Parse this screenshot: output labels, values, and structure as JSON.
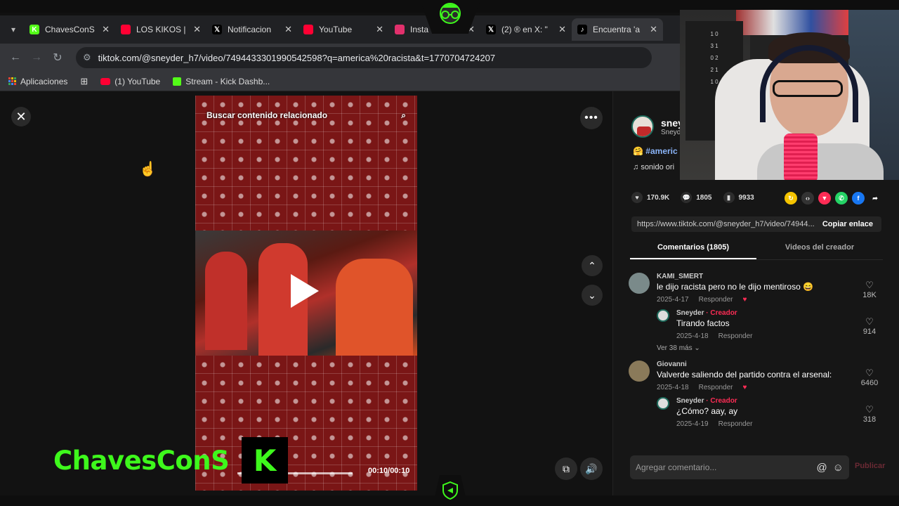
{
  "browser": {
    "tabs": [
      {
        "label": "ChavesConS",
        "icon": "kick-icon",
        "color": "#53fc18",
        "active": false
      },
      {
        "label": "LOS KIKOS |",
        "icon": "youtube-icon",
        "color": "#ff0033",
        "active": false
      },
      {
        "label": "Notificacion",
        "icon": "x-icon",
        "color": "#000000",
        "active": false
      },
      {
        "label": "YouTube",
        "icon": "youtube-icon",
        "color": "#ff0033",
        "active": false
      },
      {
        "label": "Insta",
        "icon": "instagram-icon",
        "color": "#e1306c",
        "active": false
      },
      {
        "label": "(2) ® en X: \"",
        "icon": "x-icon",
        "color": "#000000",
        "active": false
      },
      {
        "label": "Encuentra 'a",
        "icon": "tiktok-icon",
        "color": "#000000",
        "active": true
      }
    ],
    "url": "tiktok.com/@sneyder_h7/video/7494433301990542598?q=america%20racista&t=1770704724207",
    "bookmarks": [
      {
        "label": "Aplicaciones",
        "icon": "apps-grid-icon"
      },
      {
        "label": "(1) YouTube",
        "icon": "youtube-icon"
      },
      {
        "label": "Stream - Kick Dashb...",
        "icon": "kick-icon"
      }
    ]
  },
  "video": {
    "search_overlay": "Buscar contenido relacionado",
    "time": "00:10/00:10",
    "progress": 1.0
  },
  "creator": {
    "handle": "sney",
    "name": "Sneyd",
    "hashtag": "#americ",
    "sound": "sonido ori",
    "stats": {
      "likes": "170.9K",
      "comments": "1805",
      "saves": "9933"
    },
    "link": "https://www.tiktok.com/@sneyder_h7/video/74944...",
    "copy_label": "Copiar enlace"
  },
  "panel_tabs": {
    "comments": "Comentarios (1805)",
    "creator_videos": "Videos del creador"
  },
  "comments": [
    {
      "user": "KAMI_SMERT",
      "text": "le dijo racista pero no le dijo mentiroso 😄",
      "date": "2025-4-17",
      "reply_label": "Responder",
      "likes": "18K",
      "reply": false
    },
    {
      "user": "Sneyder",
      "creator_tag": " · Creador",
      "text": "Tirando factos",
      "date": "2025-4-18",
      "reply_label": "Responder",
      "likes": "914",
      "reply": true
    },
    {
      "user": "Giovanni",
      "text": "Valverde saliendo del partido contra el arsenal:",
      "date": "2025-4-18",
      "reply_label": "Responder",
      "likes": "6460",
      "reply": false
    },
    {
      "user": "Sneyder",
      "creator_tag": " · Creador",
      "text": "¿Cómo? aay, ay",
      "date": "2025-4-19",
      "reply_label": "Responder",
      "likes": "318",
      "reply": true
    }
  ],
  "more_replies": "Ver 38 más",
  "composer": {
    "placeholder": "Agregar comentario...",
    "publish": "Publicar"
  },
  "overlay": {
    "brand": "ChavesConS",
    "kick_letter": "K",
    "brand_color": "#3ef81c"
  },
  "webcam": {
    "scoreboard_lines": [
      "1 0",
      "3 1",
      "0 2",
      "2 1",
      "1 0"
    ]
  }
}
